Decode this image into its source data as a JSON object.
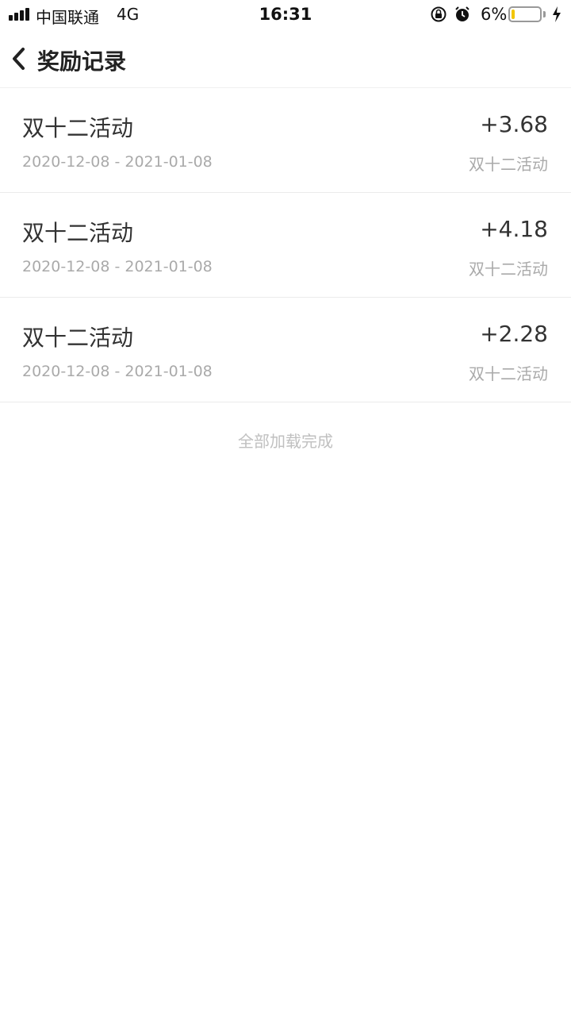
{
  "status_bar": {
    "carrier": "中国联通",
    "network": "4G",
    "time": "16:31",
    "battery_percent_label": "6%",
    "battery_level": 0.06,
    "battery_fill_color": "#f2c500",
    "icons": [
      "signal-icon",
      "rotation-lock-icon",
      "alarm-icon",
      "battery-icon",
      "charging-bolt-icon"
    ]
  },
  "nav": {
    "title": "奖励记录",
    "back_icon": "chevron-left-icon"
  },
  "records": [
    {
      "title": "双十二活动",
      "amount": "+3.68",
      "date_range": "2020-12-08 - 2021-01-08",
      "source": "双十二活动"
    },
    {
      "title": "双十二活动",
      "amount": "+4.18",
      "date_range": "2020-12-08 - 2021-01-08",
      "source": "双十二活动"
    },
    {
      "title": "双十二活动",
      "amount": "+2.28",
      "date_range": "2020-12-08 - 2021-01-08",
      "source": "双十二活动"
    }
  ],
  "footer": {
    "load_complete": "全部加载完成"
  }
}
